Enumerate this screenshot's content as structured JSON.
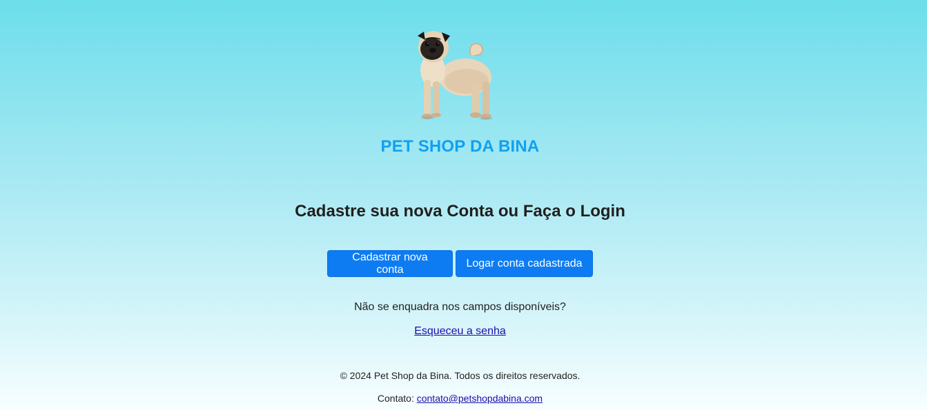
{
  "brand": {
    "name": "PET SHOP DA BINA",
    "logo": "pug-dog-image",
    "color": "#12a0f0"
  },
  "main": {
    "heading": "Cadastre sua nova Conta ou Faça o Login",
    "buttons": {
      "register_label": "Cadastrar nova conta",
      "login_label": "Logar conta cadastrada"
    },
    "question": "Não se enquadra nos campos disponíveis?",
    "forgot_password_link": "Esqueceu a senha"
  },
  "footer": {
    "copyright": "© 2024 Pet Shop da Bina. Todos os direitos reservados.",
    "contact_label": "Contato:",
    "contact_email": "contato@petshopdabina.com"
  },
  "colors": {
    "button_bg": "#0d7cf2",
    "link": "#1a0dab",
    "gradient_top": "#6cdeeb",
    "gradient_bottom": "#f8feff"
  }
}
